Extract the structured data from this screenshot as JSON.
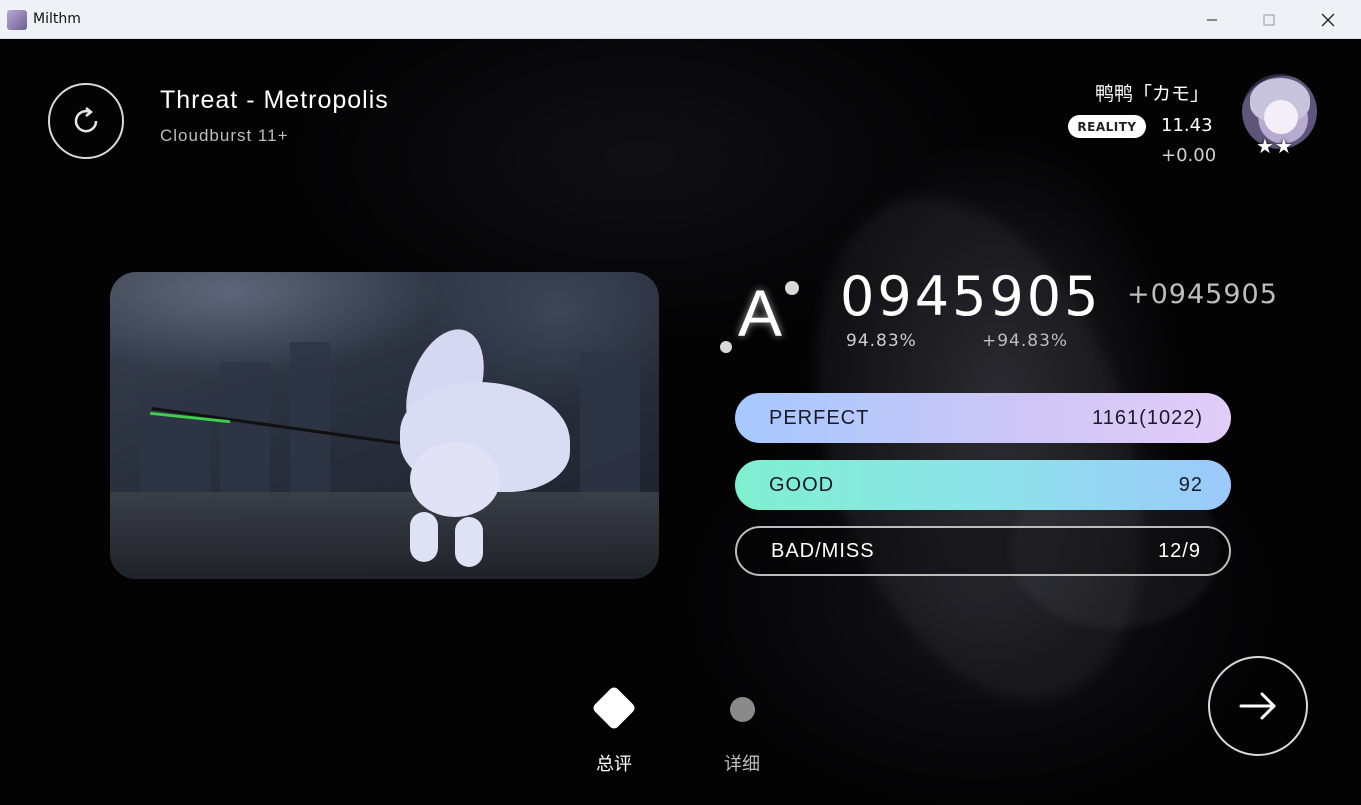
{
  "window": {
    "title": "Milthm",
    "minimize": "—",
    "maximize": "☐",
    "close": "✕"
  },
  "song": {
    "title": "Threat - Metropolis",
    "difficulty": "Cloudburst 11+"
  },
  "player": {
    "name": "鸭鸭「カモ」",
    "badge": "REALITY",
    "rating": "11.43",
    "rating_delta": "+0.00",
    "stars": "★★",
    "avatar_icon": "avatar-portrait"
  },
  "result": {
    "grade": "A",
    "score": "0945905",
    "score_delta": "+0945905",
    "accuracy": "94.83%",
    "accuracy_delta": "+94.83%"
  },
  "judgements": [
    {
      "label": "PERFECT",
      "value": "1161(1022)"
    },
    {
      "label": "GOOD",
      "value": "92"
    },
    {
      "label": "BAD/MISS",
      "value": "12/9"
    }
  ],
  "tabs": [
    {
      "label": "总评",
      "icon": "diamond-icon",
      "active": true
    },
    {
      "label": "详细",
      "icon": "dot-icon",
      "active": false
    }
  ],
  "icons": {
    "retry": "retry-icon",
    "next": "arrow-right-icon"
  },
  "colors": {
    "perfect_start": "#a6c9ff",
    "perfect_end": "#e2cdf8",
    "good_start": "#7ff0cf",
    "good_end": "#9cc9fb",
    "background": "#030304"
  }
}
